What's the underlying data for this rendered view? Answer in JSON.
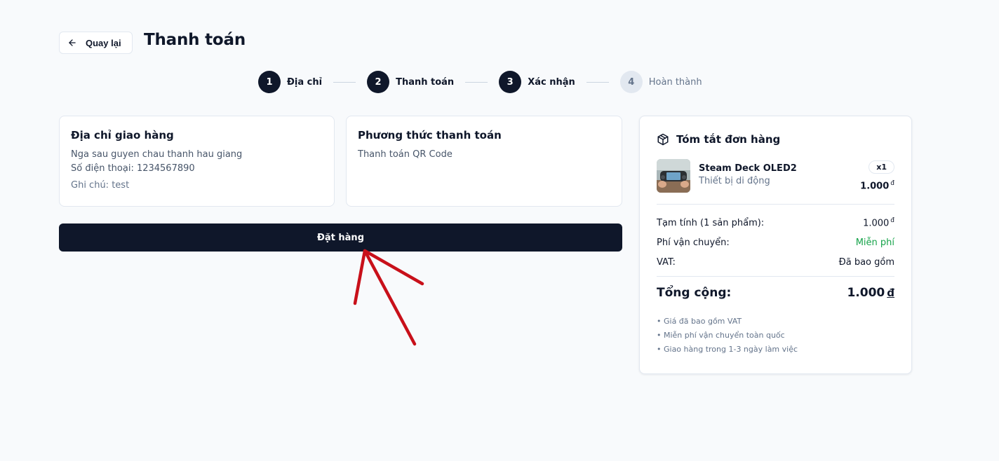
{
  "header": {
    "back_label": "Quay lại",
    "title": "Thanh toán"
  },
  "stepper": {
    "steps": [
      {
        "number": "1",
        "label": "Địa chỉ",
        "state": "done"
      },
      {
        "number": "2",
        "label": "Thanh toán",
        "state": "done"
      },
      {
        "number": "3",
        "label": "Xác nhận",
        "state": "current"
      },
      {
        "number": "4",
        "label": "Hoàn thành",
        "state": "pending"
      }
    ]
  },
  "address_card": {
    "title": "Địa chỉ giao hàng",
    "address": "Nga sau guyen chau thanh hau giang",
    "phone": "Số điện thoại: 1234567890",
    "note": "Ghi chú: test"
  },
  "payment_card": {
    "title": "Phương thức thanh toán",
    "method": "Thanh toán QR Code"
  },
  "order_button_label": "Đặt hàng",
  "summary": {
    "title": "Tóm tắt đơn hàng",
    "product": {
      "name": "Steam Deck OLED2",
      "category": "Thiết bị di động",
      "quantity": "x1",
      "price": "1.000",
      "currency": "đ"
    },
    "subtotal_label": "Tạm tính (1 sản phẩm):",
    "subtotal_value": "1.000",
    "shipping_label": "Phí vận chuyển:",
    "shipping_value": "Miễn phí",
    "vat_label": "VAT:",
    "vat_value": "Đã bao gồm",
    "total_label": "Tổng cộng:",
    "total_value": "1.000",
    "total_currency": "đ",
    "notes": [
      "• Giá đã bao gồm VAT",
      "• Miễn phí vận chuyển toàn quốc",
      "• Giao hàng trong 1-3 ngày làm việc"
    ]
  },
  "colors": {
    "primary": "#0f172a",
    "free_shipping": "#16a34a",
    "annotation_arrow": "#c8101a"
  }
}
